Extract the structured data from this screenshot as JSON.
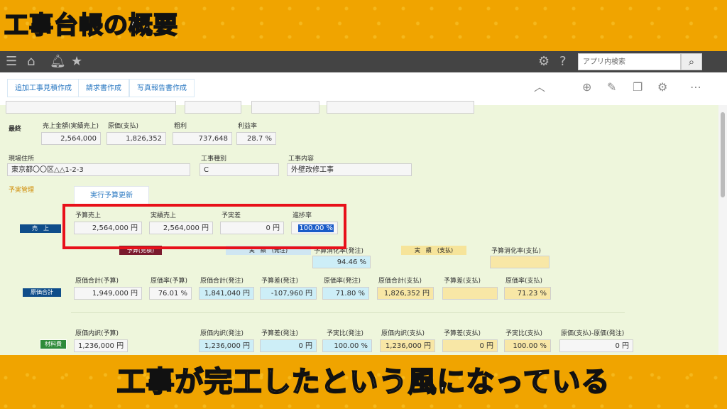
{
  "banner_title": "工事台帳の概要",
  "subtitle": "工事が完工したという風になっている",
  "topbar": {
    "search_placeholder": "アプリ内検索"
  },
  "toolbar": {
    "buttons": [
      "追加工事見積作成",
      "請求書作成",
      "写真報告書作成"
    ]
  },
  "final": {
    "label": "最終",
    "fields": [
      {
        "label": "売上金額(実績売上)",
        "value": "2,564,000"
      },
      {
        "label": "原価(支払)",
        "value": "1,826,352"
      },
      {
        "label": "粗利",
        "value": "737,648"
      },
      {
        "label": "利益率",
        "value": "28.7 %"
      }
    ]
  },
  "site": {
    "address_label": "現場住所",
    "address_value": "東京都〇〇区△△1-2-3",
    "type_label": "工事種別",
    "type_value": "C",
    "content_label": "工事内容",
    "content_value": "外壁改修工事"
  },
  "budget": {
    "section_label": "予実管理",
    "exec_button": "実行予算更新",
    "sales_tag": "売　上",
    "sales_fields": [
      {
        "label": "予算売上",
        "value": "2,564,000 円"
      },
      {
        "label": "実績売上",
        "value": "2,564,000 円"
      },
      {
        "label": "予実差",
        "value": "0 円"
      },
      {
        "label": "進捗率",
        "value": "100.00 %"
      }
    ],
    "band_budget": "予算(見積)",
    "band_actual_order": "実　績　(発注)",
    "band_actual_pay": "実　績　(支払)",
    "consumption_order_label": "予算消化率(発注)",
    "consumption_order_value": "94.46 %",
    "consumption_pay_label": "予算消化率(支払)",
    "cost_tag": "原価合計",
    "cost_fields": [
      {
        "label": "原価合計(予算)",
        "value": "1,949,000 円"
      },
      {
        "label": "原価率(予算)",
        "value": "76.01 %"
      },
      {
        "label": "原価合計(発注)",
        "value": "1,841,040 円"
      },
      {
        "label": "予算差(発注)",
        "value": "-107,960 円"
      },
      {
        "label": "原価率(発注)",
        "value": "71.80 %"
      },
      {
        "label": "原価合計(支払)",
        "value": "1,826,352 円"
      },
      {
        "label": "予算差(支払)",
        "value": ""
      },
      {
        "label": "原価率(支払)",
        "value": "71.23 %"
      }
    ],
    "material_tag": "材料費",
    "material_fields": [
      {
        "label": "原価内訳(予算)",
        "value": "1,236,000 円"
      },
      {
        "label": "原価内訳(発注)",
        "value": "1,236,000 円"
      },
      {
        "label": "予算差(発注)",
        "value": "0 円"
      },
      {
        "label": "予実比(発注)",
        "value": "100.00 %"
      },
      {
        "label": "原価内訳(支払)",
        "value": "1,236,000 円"
      },
      {
        "label": "予算差(支払)",
        "value": "0 円"
      },
      {
        "label": "予実比(支払)",
        "value": "100.00 %"
      },
      {
        "label": "原価(支払)-原価(発注)",
        "value": "0 円"
      }
    ]
  },
  "colors": {
    "accent": "#2a78c2",
    "banner_bg": "#f0a400",
    "form_bg": "#eef6dc",
    "highlight": "#e8101a"
  }
}
